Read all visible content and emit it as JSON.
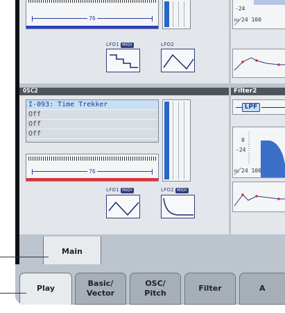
{
  "osc2": {
    "header": "OSC2",
    "multisample_list": [
      "I-093: Time Trekker",
      "Off",
      "Off",
      "Off"
    ],
    "key_range_value": "76"
  },
  "osc1": {
    "key_range_value": "76"
  },
  "lfo": {
    "lfo1_label": "LFO1",
    "lfo2_label": "LFO2",
    "midi_badge": "MIDI"
  },
  "filter2": {
    "header": "Filter2",
    "type_label": "LPF",
    "graph_y_top": "0",
    "graph_y_bottom": "-24",
    "graph_x_label": "Hz",
    "graph_x_values": "24 100"
  },
  "filter1": {
    "graph_y_bottom": "-24",
    "graph_x_label": "Hz",
    "graph_x_values": "24 100"
  },
  "page_tabs": {
    "main": "Main"
  },
  "mode_tabs": [
    {
      "line1": "Play",
      "line2": ""
    },
    {
      "line1": "Basic/",
      "line2": "Vector"
    },
    {
      "line1": "OSC/",
      "line2": "Pitch"
    },
    {
      "line1": "Filter",
      "line2": ""
    },
    {
      "line1": "A",
      "line2": ""
    }
  ],
  "colors": {
    "accent_blue": "#2466c9",
    "dark_blue": "#2d3b7a",
    "key_bar_red": "#e0303a",
    "key_bar_blue": "#2b3fc4",
    "graph_red": "#d8283a"
  }
}
